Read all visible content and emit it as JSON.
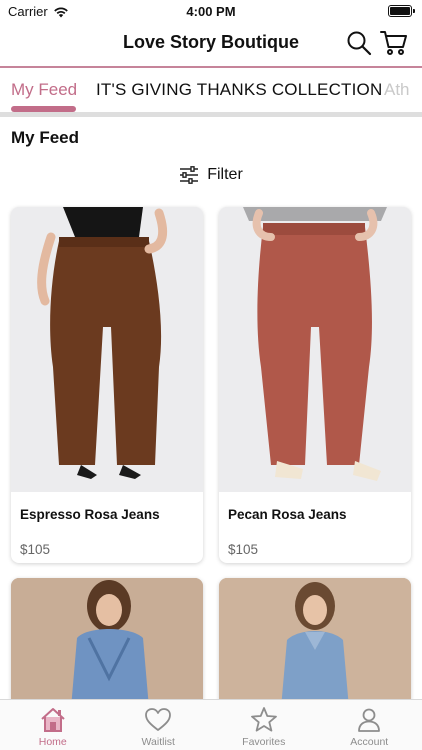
{
  "status_bar": {
    "carrier": "Carrier",
    "time": "4:00 PM"
  },
  "header": {
    "title": "Love Story Boutique"
  },
  "tabs": [
    {
      "label": "My Feed",
      "selected": true
    },
    {
      "label": "IT'S GIVING THANKS COLLECTION",
      "selected": false
    },
    {
      "label": "Ath",
      "selected": false
    }
  ],
  "page_title": "My Feed",
  "filter_label": "Filter",
  "products": [
    {
      "name": "Espresso Rosa Jeans",
      "price": "$105",
      "color": "#6b3a1f"
    },
    {
      "name": "Pecan Rosa Jeans",
      "price": "$105",
      "color": "#b0584a"
    },
    {
      "name": "",
      "price": "",
      "color": "#6f93c2"
    },
    {
      "name": "",
      "price": "",
      "color": "#7ea0c8"
    }
  ],
  "bottom_nav": [
    {
      "label": "Home",
      "icon": "home-icon",
      "active": true
    },
    {
      "label": "Waitlist",
      "icon": "heart-icon",
      "active": false
    },
    {
      "label": "Favorites",
      "icon": "star-icon",
      "active": false
    },
    {
      "label": "Account",
      "icon": "person-icon",
      "active": false
    }
  ],
  "colors": {
    "accent": "#c26d89",
    "tab_border": "#c6849a"
  }
}
